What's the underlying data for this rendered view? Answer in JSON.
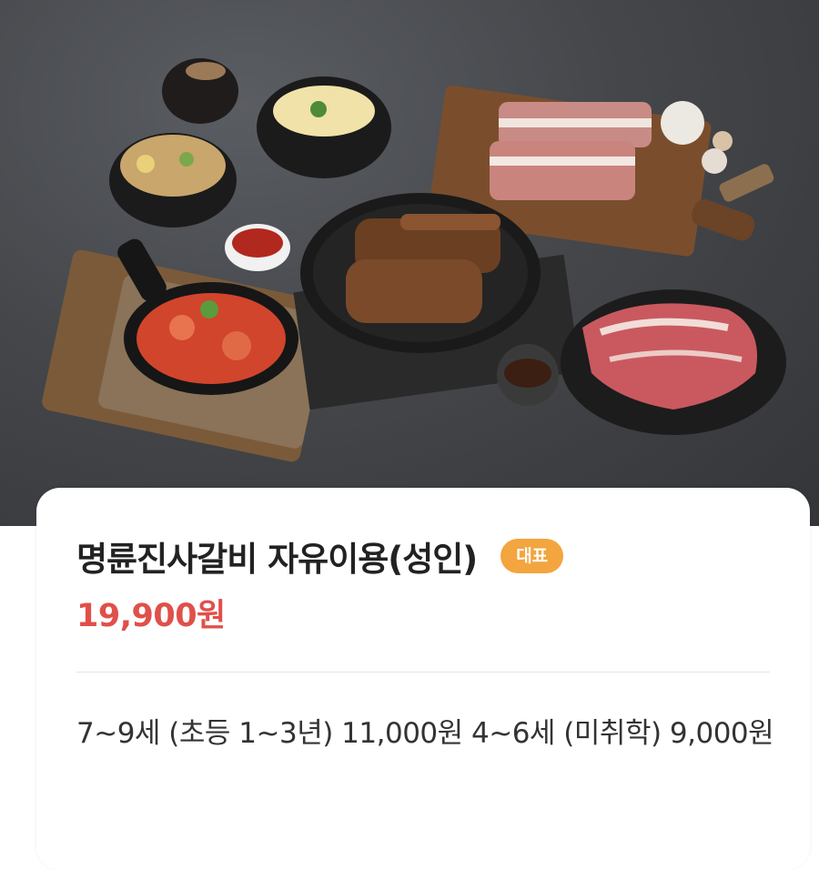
{
  "product": {
    "image_alt": "음식 사진",
    "title": "명륜진사갈비 자유이용(성인)",
    "badge": "대표",
    "price": "19,900원",
    "description": "7~9세 (초등 1~3년) 11,000원 4~6세 (미취학) 9,000원"
  },
  "colors": {
    "price": "#e0504a",
    "badge": "#f3a53f"
  }
}
